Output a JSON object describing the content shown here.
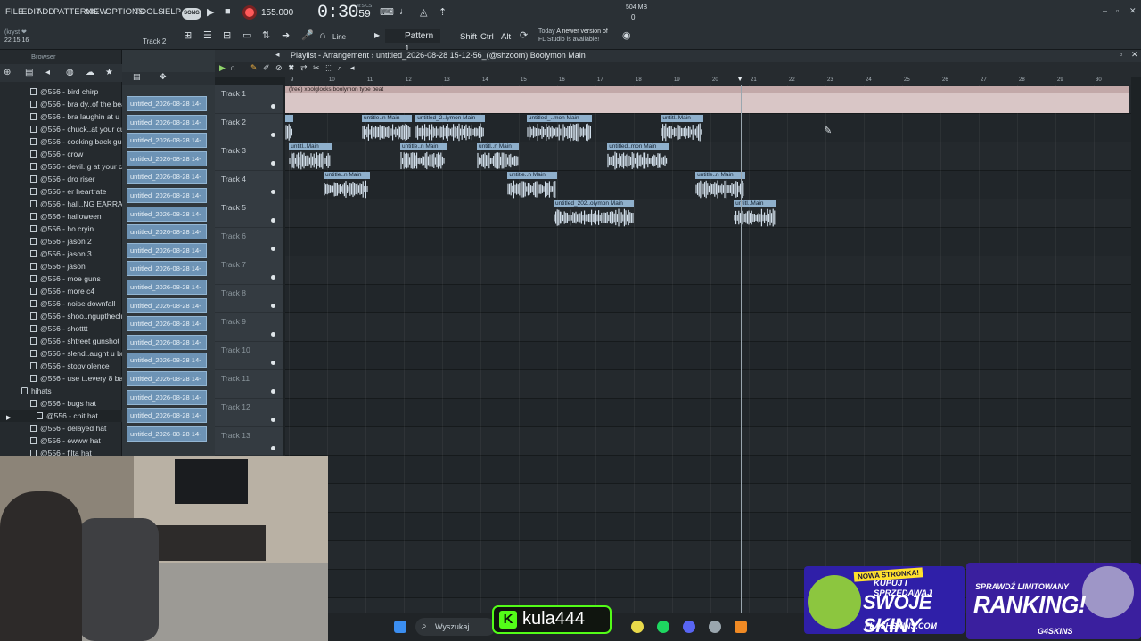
{
  "menu": [
    "FILE",
    "EDIT",
    "ADD",
    "PATTERNS",
    "VIEW",
    "OPTIONS",
    "TOOLS",
    "HELP"
  ],
  "transport": {
    "song_badge": "SONG",
    "tempo": "155.000",
    "time_main": "0:30",
    "time_sub": "59",
    "time_unit": "M:S:CS"
  },
  "status": {
    "memory": "504 MB",
    "cpu": "0"
  },
  "hint": {
    "user": "(kryst ❤",
    "time": "22:15:16",
    "track": "Track 2"
  },
  "toolbar2": {
    "snap_label": "Line",
    "pattern": "Pattern 1",
    "shift": "Shift",
    "ctrl": "Ctrl",
    "alt": "Alt",
    "news_date": "Today",
    "news_text": "A newer version of",
    "news_text2": "FL Studio is available!"
  },
  "browser": {
    "title": "Browser",
    "items": [
      {
        "label": "@556 - bird chirp",
        "type": "file"
      },
      {
        "label": "@556 - bra dy..of the beat",
        "type": "file"
      },
      {
        "label": "@556 - bra laughin at u",
        "type": "file"
      },
      {
        "label": "@556 - chuck..at your cut",
        "type": "file"
      },
      {
        "label": "@556 - cocking back gun",
        "type": "file"
      },
      {
        "label": "@556 - crow",
        "type": "file"
      },
      {
        "label": "@556 - devil..g at your cut",
        "type": "file"
      },
      {
        "label": "@556 - dro riser",
        "type": "file"
      },
      {
        "label": "@556 - er heartrate",
        "type": "file"
      },
      {
        "label": "@556 - hall..NG EARRAPE)",
        "type": "file"
      },
      {
        "label": "@556 - halloween",
        "type": "file"
      },
      {
        "label": "@556 - ho cryin",
        "type": "file"
      },
      {
        "label": "@556 - jason 2",
        "type": "file"
      },
      {
        "label": "@556 - jason 3",
        "type": "file"
      },
      {
        "label": "@556 - jason",
        "type": "file"
      },
      {
        "label": "@556 - moe guns",
        "type": "file"
      },
      {
        "label": "@556 - more c4",
        "type": "file"
      },
      {
        "label": "@556 - noise downfall",
        "type": "file"
      },
      {
        "label": "@556 - shoo..nguptheclub",
        "type": "file"
      },
      {
        "label": "@556 - shotttt",
        "type": "file"
      },
      {
        "label": "@556 - shtreet gunshot",
        "type": "file"
      },
      {
        "label": "@556 - slend..aught u bro",
        "type": "file"
      },
      {
        "label": "@556 - stopviolence",
        "type": "file"
      },
      {
        "label": "@556 - use t..every 8 bars",
        "type": "file"
      },
      {
        "label": "hihats",
        "type": "folder"
      },
      {
        "label": "@556 - bugs hat",
        "type": "file"
      },
      {
        "label": "@556 - chit hat",
        "type": "selected"
      },
      {
        "label": "@556 - delayed hat",
        "type": "file"
      },
      {
        "label": "@556 - ewww hat",
        "type": "file"
      },
      {
        "label": "@556 - filta hat",
        "type": "file"
      }
    ]
  },
  "strip": {
    "clips": [
      "untitled_2026-08-28 14-",
      "untitled_2026-08-28 14-",
      "untitled_2026-08-28 14-",
      "untitled_2026-08-28 14-",
      "untitled_2026-08-28 14-",
      "untitled_2026-08-28 14-",
      "untitled_2026-08-28 14-",
      "untitled_2026-08-28 14-",
      "untitled_2026-08-28 14-",
      "untitled_2026-08-28 14-",
      "untitled_2026-08-28 14-",
      "untitled_2026-08-28 14-",
      "untitled_2026-08-28 14-",
      "untitled_2026-08-28 14-",
      "untitled_2026-08-28 14-",
      "untitled_2026-08-28 14-",
      "untitled_2026-08-28 14-",
      "untitled_2026-08-28 14-",
      "untitled_2026-08-28 14-"
    ]
  },
  "playlist": {
    "title": "Playlist - Arrangement",
    "breadcrumb": "untitled_2026-08-28 15-12-56_(@shzoom) Boolymon Main",
    "bars": [
      "9",
      "10",
      "11",
      "12",
      "13",
      "14",
      "15",
      "16",
      "17",
      "18",
      "19",
      "20",
      "21",
      "22",
      "23",
      "24",
      "25",
      "26",
      "27",
      "28",
      "29",
      "30"
    ],
    "tracks": [
      "Track 1",
      "Track 2",
      "Track 3",
      "Track 4",
      "Track 5",
      "Track 6",
      "Track 7",
      "Track 8",
      "Track 9",
      "Track 10",
      "Track 11",
      "Track 12",
      "Track 13"
    ],
    "first_clip": "(free) xoolglocks boolymon type beat",
    "clips": [
      {
        "track": 1,
        "label": "",
        "start": 9.0,
        "end": 9.2
      },
      {
        "track": 1,
        "label": "untitle..n Main",
        "start": 11.0,
        "end": 12.3
      },
      {
        "track": 1,
        "label": "untitled_2..lymon Main",
        "start": 12.4,
        "end": 14.2
      },
      {
        "track": 1,
        "label": "untitled_..mon Main",
        "start": 15.3,
        "end": 17.0
      },
      {
        "track": 1,
        "label": "untitl..Main",
        "start": 18.8,
        "end": 19.9
      },
      {
        "track": 2,
        "label": "untitl..Main",
        "start": 9.1,
        "end": 10.2
      },
      {
        "track": 2,
        "label": "untitle..n Main",
        "start": 12.0,
        "end": 13.2
      },
      {
        "track": 2,
        "label": "untitl..n Main",
        "start": 14.0,
        "end": 15.1
      },
      {
        "track": 2,
        "label": "untitled..mon Main",
        "start": 17.4,
        "end": 19.0
      },
      {
        "track": 3,
        "label": "untitle..n Main",
        "start": 10.0,
        "end": 11.2
      },
      {
        "track": 3,
        "label": "untitle..n Main",
        "start": 14.8,
        "end": 16.1
      },
      {
        "track": 3,
        "label": "untitle..n Main",
        "start": 19.7,
        "end": 21.0
      },
      {
        "track": 4,
        "label": "untitled_202..olymon Main",
        "start": 16.0,
        "end": 18.1
      },
      {
        "track": 4,
        "label": "untitl..Main",
        "start": 20.7,
        "end": 21.8
      }
    ]
  },
  "taskbar": {
    "search_placeholder": "Wyszukaj"
  },
  "overlays": {
    "kula": "kula444",
    "ad1_badge": "NOWA STRONKA!",
    "ad1_line1": "KUPUJ I SPRZEDAWAJ",
    "ad1_line2": "SWOJE SKINY",
    "ad1_brand": "FLASHSKINS.COM",
    "ad2_line1": "SPRAWDŹ LIMITOWANY",
    "ad2_line2": "RANKING!",
    "ad2_brand": "G4SKINS"
  },
  "colors": {
    "clip_header": "#8fb0cc",
    "clip_wave": "#dbe8f4",
    "record": "#ff5a5a",
    "kick_green": "#53fc18"
  }
}
